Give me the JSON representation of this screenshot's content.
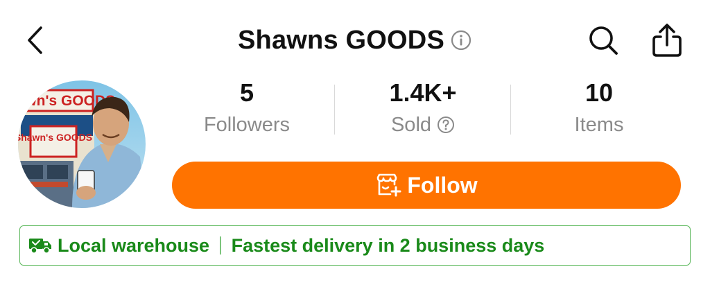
{
  "header": {
    "title": "Shawns GOODS",
    "icons": {
      "back": "chevron-left-icon",
      "info": "info-icon",
      "search": "search-icon",
      "share": "share-icon"
    }
  },
  "avatar": {
    "sign_text_top": "Shawn's GOODS",
    "sign_text_bottom": "Shawn's GOODS"
  },
  "stats": [
    {
      "value": "5",
      "label": "Followers"
    },
    {
      "value": "1.4K+",
      "label": "Sold",
      "icon": "help-icon"
    },
    {
      "value": "10",
      "label": "Items"
    }
  ],
  "follow_button": {
    "label": "Follow",
    "icon": "follow-store-icon"
  },
  "banner": {
    "icon": "truck-icon",
    "left_text": "Local warehouse",
    "right_text": "Fastest delivery in 2 business days"
  },
  "colors": {
    "accent": "#ff7300",
    "banner_green": "#1a8a1a",
    "label_gray": "#8a8a8a"
  }
}
